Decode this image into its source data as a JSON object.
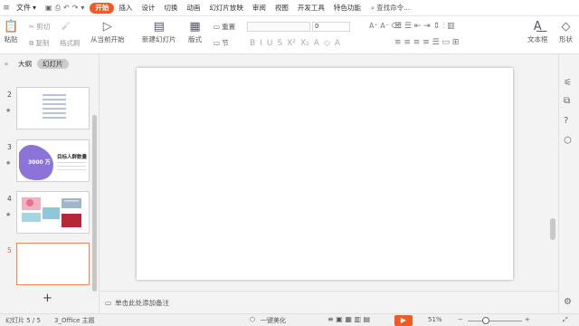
{
  "menu": {
    "file": "文件",
    "tabs": [
      "开始",
      "插入",
      "设计",
      "切换",
      "动画",
      "幻灯片放映",
      "审阅",
      "视图",
      "开发工具",
      "特色功能"
    ],
    "search": "查找命令..."
  },
  "ribbon": {
    "paste": "粘贴",
    "cut": "剪切",
    "copy": "复制",
    "format_painter": "格式刷",
    "play_from_current": "从当前开始",
    "new_slide": "新建幻灯片",
    "layout": "版式",
    "reset": "重置",
    "section": "节",
    "font_size": "0",
    "text_box": "文本框",
    "shape": "形状"
  },
  "panel": {
    "outline_tab": "大纲",
    "slides_tab": "幻灯片",
    "slides": [
      {
        "num": "2",
        "star": "★",
        "title": ""
      },
      {
        "num": "3",
        "star": "★",
        "title": "目标人群数量",
        "badge": "3000 万"
      },
      {
        "num": "4",
        "star": "★",
        "title": ""
      },
      {
        "num": "5",
        "star": "",
        "title": ""
      }
    ],
    "add": "+"
  },
  "notes": {
    "placeholder": "单击此处添加备注"
  },
  "status": {
    "slide_counter": "幻灯片 5 / 5",
    "theme": "3_Office 主题",
    "beautify": "一键美化",
    "zoom": "51%"
  },
  "colors": {
    "accent": "#f15a24",
    "purple": "#8b73d9"
  }
}
